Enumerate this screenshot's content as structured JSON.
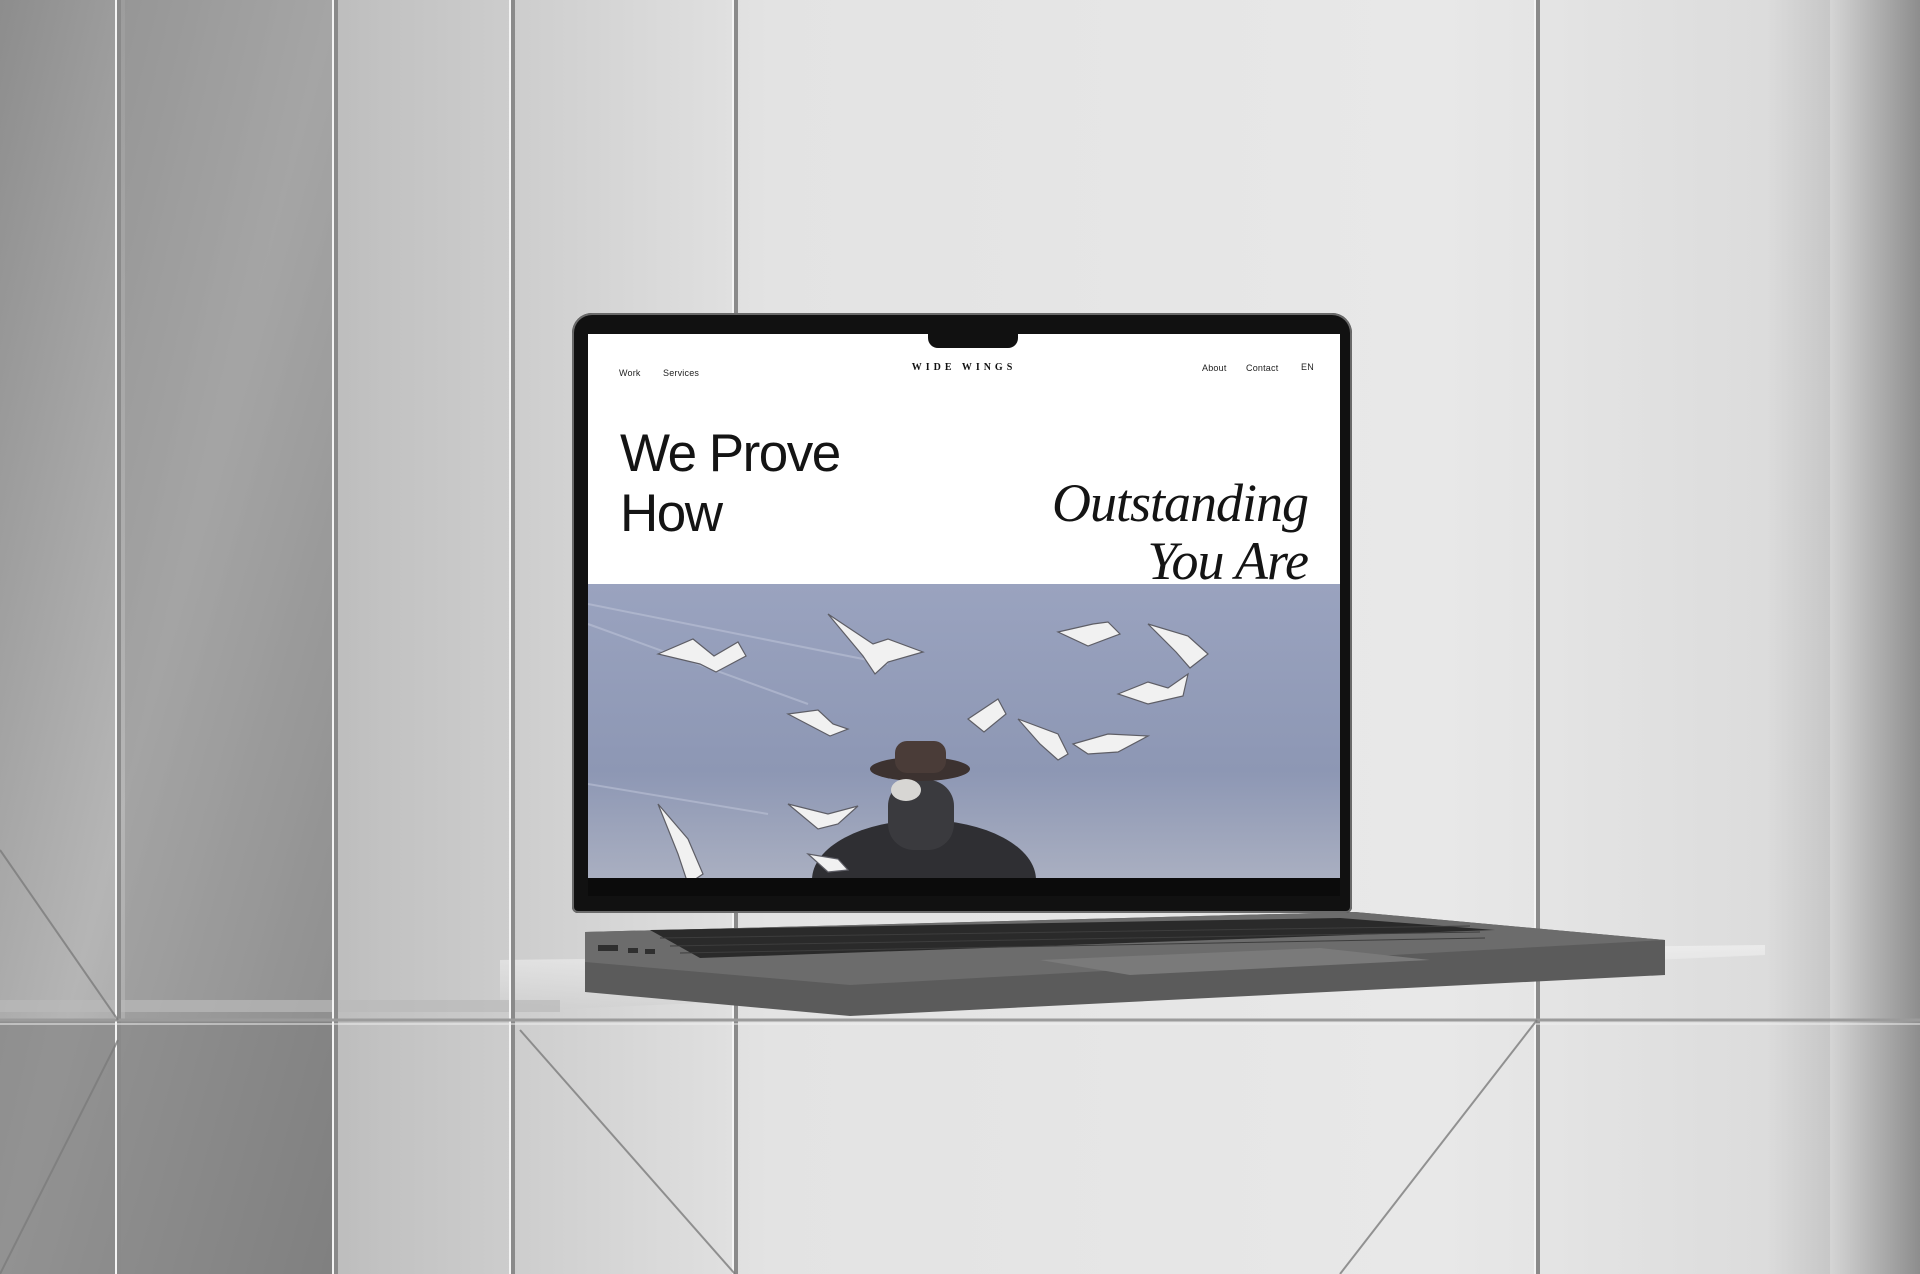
{
  "website": {
    "nav_left": [
      "Work",
      "Services"
    ],
    "brand": "WIDE WINGS",
    "nav_right": [
      "About",
      "Contact",
      "EN"
    ]
  },
  "hero": {
    "headline_left": [
      "We Prove",
      "How"
    ],
    "headline_right": [
      "Outstanding",
      "You Are"
    ],
    "image": "man-in-hat-with-seagulls-photo"
  },
  "colors": {
    "page_bg": "#ffffff",
    "text": "#141414",
    "sky": "#8d97b4",
    "laptop": "#5f5f5f"
  }
}
